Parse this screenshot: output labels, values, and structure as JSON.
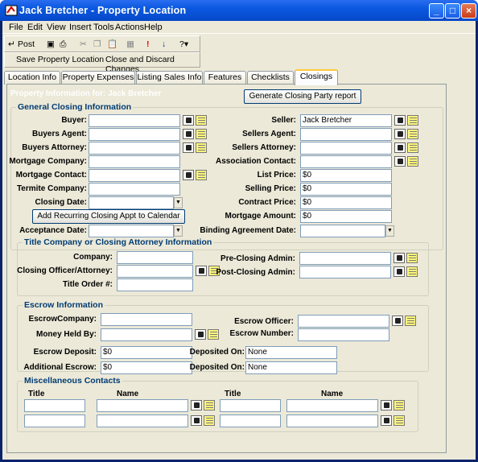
{
  "window": {
    "title": "Jack Bretcher - Property Location",
    "min_icon": "minimize-icon",
    "max_icon": "maximize-icon",
    "close_icon": "close-icon"
  },
  "menu": [
    "File",
    "Edit",
    "View",
    "Insert",
    "Tools",
    "Actions",
    "Help"
  ],
  "toolbar": {
    "post": "Post"
  },
  "actions": {
    "save": "Save Property Location",
    "close": "Close and Discard Changes"
  },
  "tabs": [
    "Location Info",
    "Property Expenses",
    "Listing Sales Info",
    "Features",
    "Checklists",
    "Closings"
  ],
  "active_tab": "Closings",
  "header": {
    "property_info": "Property Information for: Jack Bretcher",
    "generate": "Generate Closing Party report"
  },
  "general": {
    "legend": "General Closing Information",
    "buyer": "Buyer:",
    "buyers_agent": "Buyers Agent:",
    "buyers_attorney": "Buyers Attorney:",
    "mortgage_company": "Mortgage Company:",
    "mortgage_contact": "Mortgage Contact:",
    "termite_company": "Termite Company:",
    "closing_date": "Closing Date:",
    "add_recurring": "Add Recurring Closing Appt to Calendar",
    "acceptance_date": "Acceptance Date:",
    "seller": "Seller:",
    "seller_value": "Jack Bretcher",
    "sellers_agent": "Sellers Agent:",
    "sellers_attorney": "Sellers Attorney:",
    "association_contact": "Association Contact:",
    "list_price": "List Price:",
    "list_price_value": "$0",
    "selling_price": "Selling Price:",
    "selling_price_value": "$0",
    "contract_price": "Contract Price:",
    "contract_price_value": "$0",
    "mortgage_amount": "Mortgage Amount:",
    "mortgage_amount_value": "$0",
    "binding_date": "Binding Agreement Date:"
  },
  "title_co": {
    "legend": "Title Company or Closing Attorney Information",
    "company": "Company:",
    "officer": "Closing Officer/Attorney:",
    "order": "Title Order #:",
    "pre": "Pre-Closing Admin:",
    "post": "Post-Closing Admin:"
  },
  "escrow": {
    "legend": "Escrow Information",
    "company": "EscrowCompany:",
    "money": "Money Held By:",
    "deposit": "Escrow Deposit:",
    "deposit_value": "$0",
    "additional": "Additional Escrow:",
    "additional_value": "$0",
    "officer": "Escrow Officer:",
    "number": "Escrow Number:",
    "deposited1": "Deposited On:",
    "deposited1_value": "None",
    "deposited2": "Deposited On:",
    "deposited2_value": "None"
  },
  "misc": {
    "legend": "Miscellaneous Contacts",
    "title_head": "Title",
    "name_head": "Name"
  }
}
